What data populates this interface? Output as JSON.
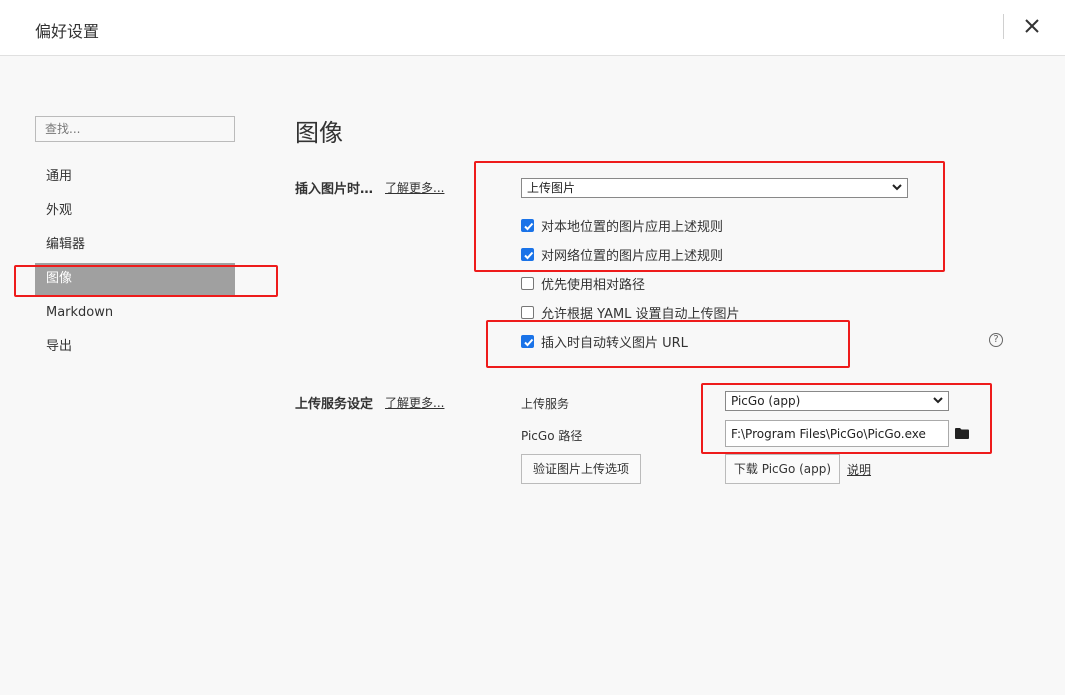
{
  "window": {
    "title": "偏好设置",
    "close_icon": "close-icon"
  },
  "sidebar": {
    "search_placeholder": "查找...",
    "items": [
      {
        "label": "通用"
      },
      {
        "label": "外观"
      },
      {
        "label": "编辑器"
      },
      {
        "label": "图像",
        "active": true
      },
      {
        "label": "Markdown"
      },
      {
        "label": "导出"
      }
    ]
  },
  "main": {
    "title": "图像",
    "insert": {
      "label": "插入图片时…",
      "learn_more": "了解更多...",
      "action_value": "上传图片",
      "options": [
        {
          "label": "对本地位置的图片应用上述规则",
          "checked": true
        },
        {
          "label": "对网络位置的图片应用上述规则",
          "checked": true
        },
        {
          "label": "优先使用相对路径",
          "checked": false
        },
        {
          "label": "允许根据 YAML 设置自动上传图片",
          "checked": false
        },
        {
          "label": "插入时自动转义图片 URL",
          "checked": true
        }
      ],
      "help_icon": "help-icon",
      "help_glyph": "?"
    },
    "upload": {
      "label": "上传服务设定",
      "learn_more": "了解更多...",
      "service_label": "上传服务",
      "service_value": "PicGo (app)",
      "path_label": "PicGo 路径",
      "path_value": "F:\\Program Files\\PicGo\\PicGo.exe",
      "verify_button": "验证图片上传选项",
      "download_button": "下载 PicGo (app)",
      "explain_link": "说明"
    }
  },
  "colors": {
    "accent": "#1a73e8",
    "sidebar_active": "#a0a0a0",
    "highlight_box": "#ee1b1b"
  }
}
